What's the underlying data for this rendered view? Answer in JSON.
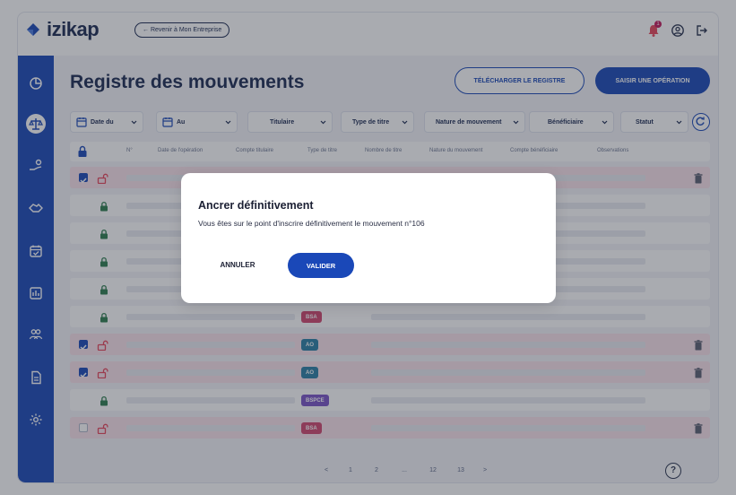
{
  "app": {
    "brand": "izikap",
    "back_label": "← Revenir à Mon Entreprise",
    "notification_count": "1"
  },
  "page": {
    "title": "Registre des mouvements",
    "download_label": "TÉLÉCHARGER LE REGISTRE",
    "new_operation_label": "SAISIR UNE OPÉRATION"
  },
  "filters": [
    {
      "label": "Date du"
    },
    {
      "label": "Au"
    },
    {
      "label": "Titulaire"
    },
    {
      "label": "Type de titre"
    },
    {
      "label": "Nature de mouvement"
    },
    {
      "label": "Bénéficiaire"
    },
    {
      "label": "Statut"
    }
  ],
  "table": {
    "headers": [
      "N°",
      "Date de l'opération",
      "Compte titulaire",
      "Type de titre",
      "Nombre de titre",
      "Nature du mouvement",
      "Compte bénéficiaire",
      "Observations"
    ],
    "rows": [
      {
        "checked": "on",
        "locked": false,
        "chip": "",
        "trash": true
      },
      {
        "checked": "",
        "locked": true,
        "chip": "",
        "trash": false
      },
      {
        "checked": "",
        "locked": true,
        "chip": "",
        "trash": false
      },
      {
        "checked": "",
        "locked": true,
        "chip": "",
        "trash": false
      },
      {
        "checked": "",
        "locked": true,
        "chip": "",
        "trash": false
      },
      {
        "checked": "",
        "locked": true,
        "chip": "BSA",
        "trash": false
      },
      {
        "checked": "on",
        "locked": false,
        "chip": "AO",
        "trash": true
      },
      {
        "checked": "on",
        "locked": false,
        "chip": "AO",
        "trash": true
      },
      {
        "checked": "",
        "locked": true,
        "chip": "BSPCE",
        "trash": false
      },
      {
        "checked": "off",
        "locked": false,
        "chip": "BSA",
        "trash": true
      }
    ]
  },
  "pagination": {
    "prev": "<",
    "pages": [
      "1",
      "2",
      "...",
      "12",
      "13"
    ],
    "next": ">"
  },
  "help_label": "?",
  "modal": {
    "title": "Ancrer définitivement",
    "message": "Vous êtes sur le point d'inscrire définitivement le mouvement n°106",
    "cancel_label": "ANNULER",
    "confirm_label": "VALIDER"
  },
  "colors": {
    "primary": "#1a48b8",
    "navy": "#1b2a52",
    "lock_green": "#2e7d4f",
    "lock_red": "#e8455b",
    "chip_bsa": "#d0476f",
    "chip_ao": "#2a7fa6",
    "chip_bspce": "#7a54c7",
    "row_pink": "#fbe3ec"
  }
}
